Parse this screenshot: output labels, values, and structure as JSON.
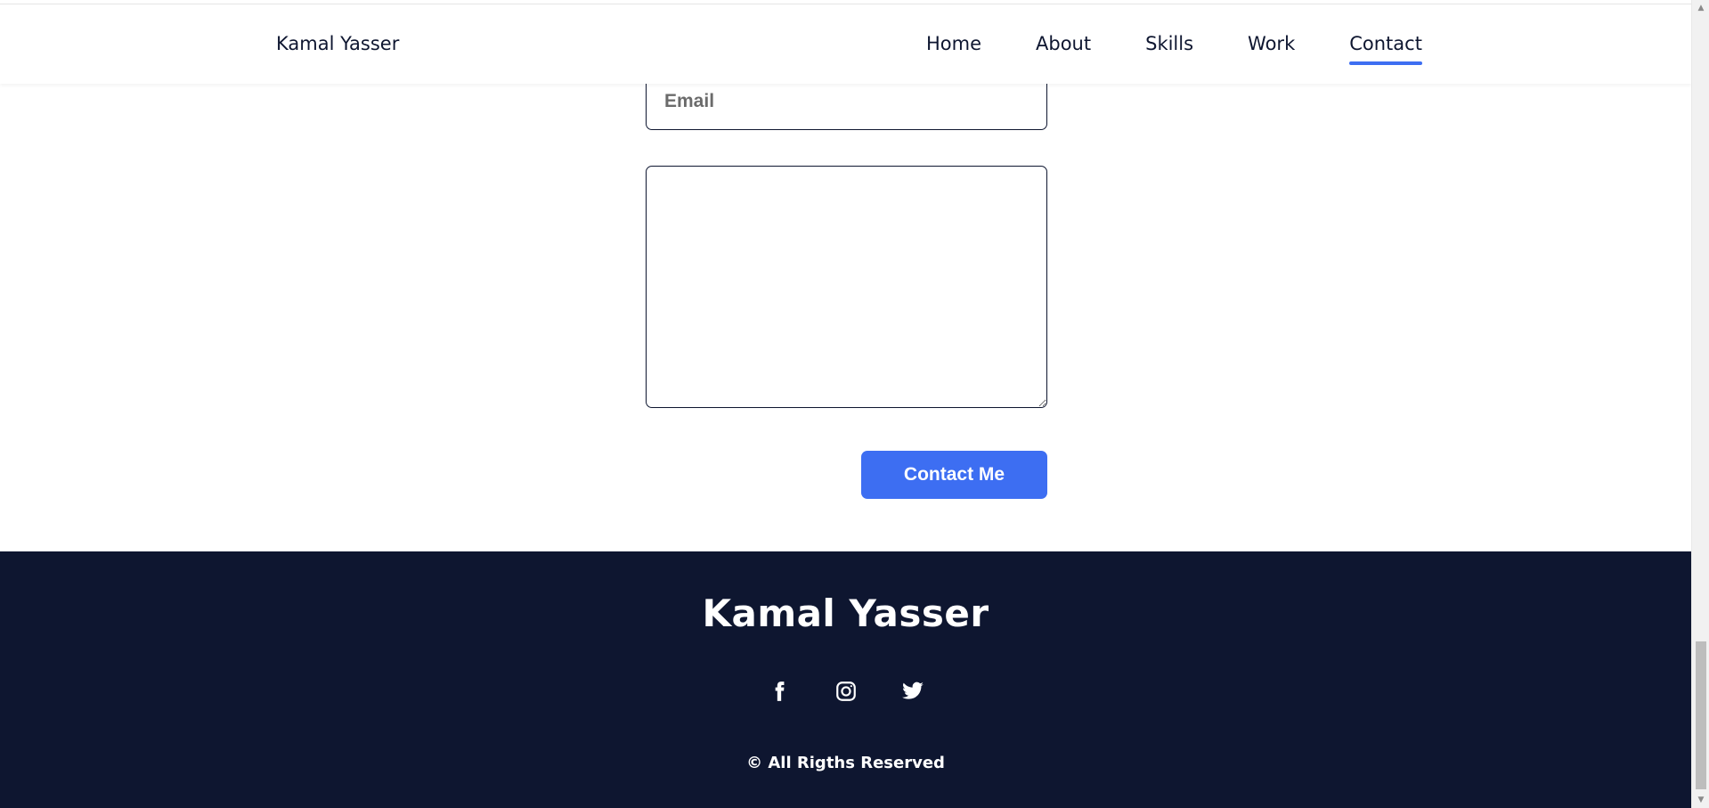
{
  "header": {
    "brand": "Kamal Yasser",
    "nav": [
      {
        "label": "Home",
        "active": false
      },
      {
        "label": "About",
        "active": false
      },
      {
        "label": "Skills",
        "active": false
      },
      {
        "label": "Work",
        "active": false
      },
      {
        "label": "Contact",
        "active": true
      }
    ]
  },
  "form": {
    "email_placeholder": "Email",
    "email_value": "",
    "message_value": "",
    "submit_label": "Contact Me"
  },
  "footer": {
    "title": "Kamal Yasser",
    "socials": [
      "facebook-icon",
      "instagram-icon",
      "twitter-icon"
    ],
    "copyright": "© All Rigths Reserved"
  },
  "colors": {
    "accent": "#3d6ef2",
    "dark": "#0e1630",
    "background": "#ffffff"
  }
}
